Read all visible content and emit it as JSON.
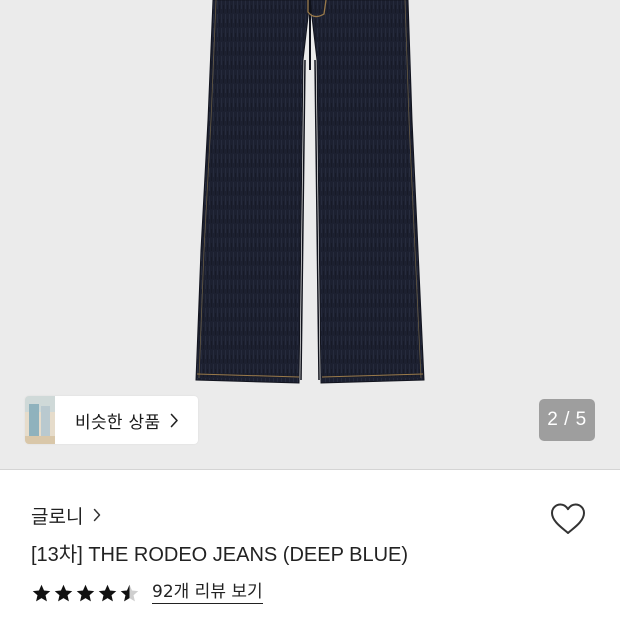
{
  "gallery": {
    "current_page": 2,
    "total_pages": 5,
    "counter_text": "2 / 5",
    "background_color": "#ebebeb",
    "denim_color": "#1c2030",
    "stitch_color": "#9a7a4a"
  },
  "similar": {
    "label": "비슷한 상품",
    "chevron_icon": "chevron-right-icon"
  },
  "product": {
    "brand": "글로니",
    "brand_chevron_icon": "chevron-right-icon",
    "title": "[13차] THE RODEO JEANS (DEEP BLUE)",
    "wishlist_icon": "heart-outline-icon",
    "rating": 4.5,
    "rating_max": 5,
    "review_link_text": "92개 리뷰 보기"
  }
}
